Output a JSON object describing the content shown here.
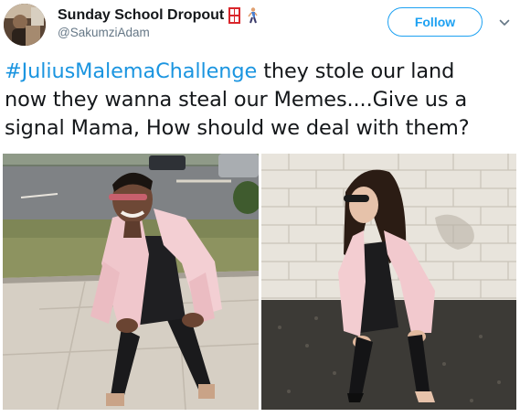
{
  "tweet": {
    "display_name": "Sunday School Dropout",
    "handle": "@SakumziAdam",
    "follow_label": "Follow",
    "hashtag": "#JuliusMalemaChallenge",
    "body_line1": " they stole our land",
    "body_line2": "now they wanna steal our Memes....Give us a",
    "body_line3": "signal Mama, How should we deal with them?",
    "name_emojis": [
      "door-emoji",
      "person-walking-emoji"
    ],
    "icons": {
      "caret": "chevron-down-icon"
    },
    "colors": {
      "accent": "#1da1f2",
      "hashtag": "#1b95e0",
      "text": "#14171a",
      "secondary": "#657786"
    },
    "media": [
      {
        "name": "woman-pink-blazer-outdoors-photo"
      },
      {
        "name": "woman-pink-blazer-wall-photo"
      }
    ]
  }
}
